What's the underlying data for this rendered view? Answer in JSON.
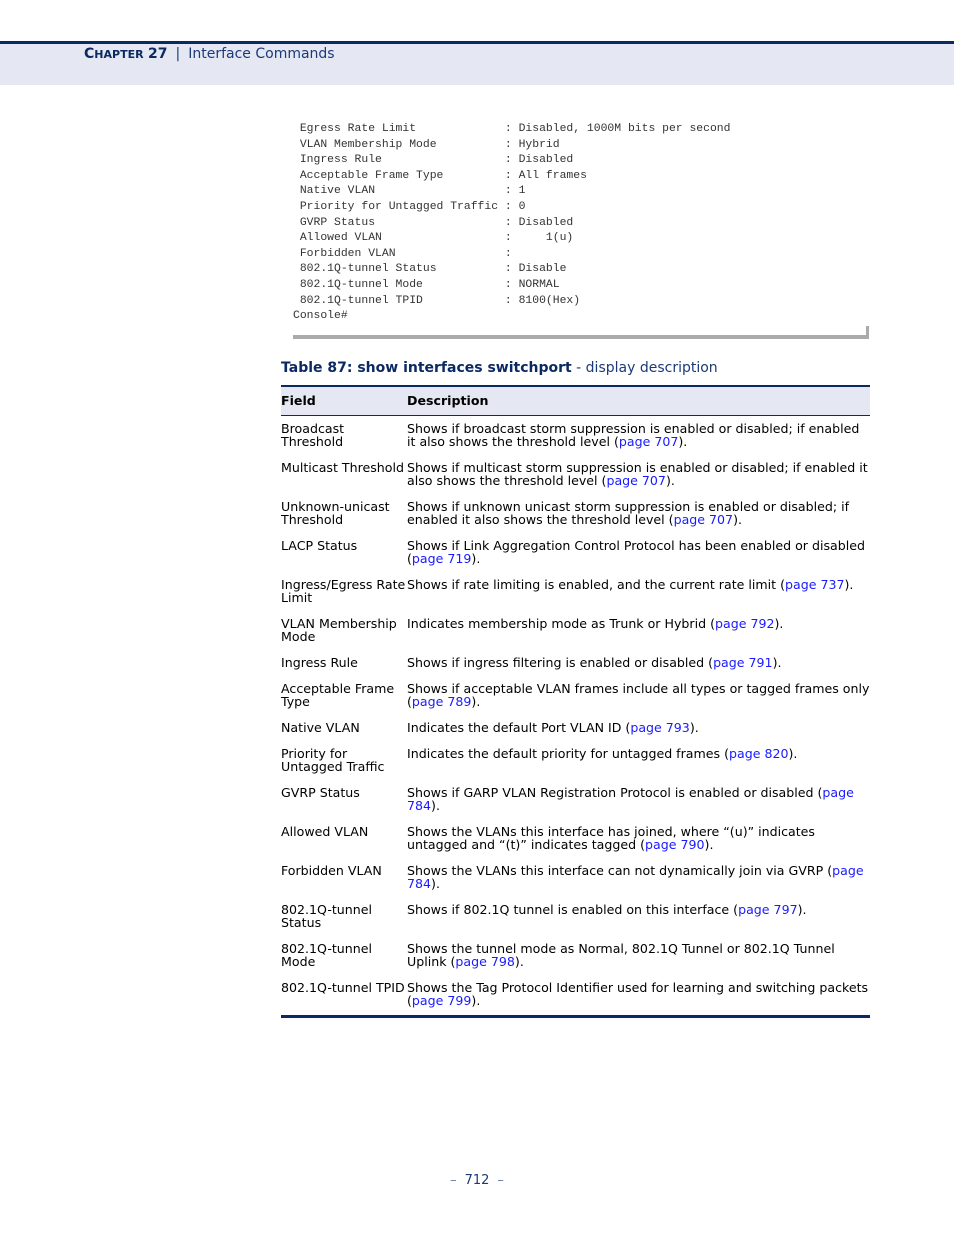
{
  "header": {
    "chapter_label": "Chapter",
    "chapter_number": "27",
    "separator": "|",
    "section_title": "Interface Commands"
  },
  "console": {
    "lines": [
      " Egress Rate Limit             : Disabled, 1000M bits per second",
      " VLAN Membership Mode          : Hybrid",
      " Ingress Rule                  : Disabled",
      " Acceptable Frame Type         : All frames",
      " Native VLAN                   : 1",
      " Priority for Untagged Traffic : 0",
      " GVRP Status                   : Disabled",
      " Allowed VLAN                  :     1(u)",
      " Forbidden VLAN                :",
      " 802.1Q-tunnel Status          : Disable",
      " 802.1Q-tunnel Mode            : NORMAL",
      " 802.1Q-tunnel TPID            : 8100(Hex)",
      "Console#"
    ]
  },
  "table": {
    "title_bold": "Table 87: show interfaces switchport",
    "title_rest": " - display description",
    "columns": [
      "Field",
      "Description"
    ],
    "rows": [
      {
        "field": "Broadcast Threshold",
        "desc": "Shows if broadcast storm suppression is enabled or disabled; if enabled it also shows the threshold level (",
        "link": "page 707",
        "end": ")."
      },
      {
        "field": "Multicast Threshold",
        "desc": "Shows if multicast storm suppression is enabled or disabled; if enabled it also shows the threshold level (",
        "link": "page 707",
        "end": ")."
      },
      {
        "field": "Unknown-unicast Threshold",
        "desc": "Shows if unknown unicast storm suppression is enabled or disabled; if enabled it also shows the threshold level (",
        "link": "page 707",
        "end": ")."
      },
      {
        "field": "LACP Status",
        "desc": "Shows if Link Aggregation Control Protocol has been enabled or disabled (",
        "link": "page 719",
        "end": ")."
      },
      {
        "field": "Ingress/Egress Rate Limit",
        "desc": "Shows if rate limiting is enabled, and the current rate limit (",
        "link": "page 737",
        "end": ")."
      },
      {
        "field": "VLAN Membership Mode",
        "desc": "Indicates membership mode as Trunk or Hybrid (",
        "link": "page 792",
        "end": ")."
      },
      {
        "field": "Ingress Rule",
        "desc": "Shows if ingress filtering is enabled or disabled (",
        "link": "page 791",
        "end": ")."
      },
      {
        "field": "Acceptable Frame Type",
        "desc": "Shows if acceptable VLAN frames include all types or tagged frames only (",
        "link": "page 789",
        "end": ")."
      },
      {
        "field": "Native VLAN",
        "desc": "Indicates the default Port VLAN ID (",
        "link": "page 793",
        "end": ")."
      },
      {
        "field": "Priority for Untagged Traffic",
        "desc": "Indicates the default priority for untagged frames (",
        "link": "page 820",
        "end": ")."
      },
      {
        "field": "GVRP Status",
        "desc": "Shows if GARP VLAN Registration Protocol is enabled or disabled (",
        "link": "page 784",
        "end": ")."
      },
      {
        "field": "Allowed VLAN",
        "desc": "Shows the VLANs this interface has joined, where “(u)” indicates untagged and “(t)” indicates tagged (",
        "link": "page 790",
        "end": ")."
      },
      {
        "field": "Forbidden VLAN",
        "desc": "Shows the VLANs this interface can not dynamically join via GVRP (",
        "link": "page 784",
        "end": ")."
      },
      {
        "field": "802.1Q-tunnel Status",
        "desc": "Shows if 802.1Q tunnel is enabled on this interface (",
        "link": "page 797",
        "end": ")."
      },
      {
        "field": "802.1Q-tunnel Mode",
        "desc": "Shows the tunnel mode as Normal, 802.1Q Tunnel or 802.1Q Tunnel Uplink (",
        "link": "page 798",
        "end": ")."
      },
      {
        "field": "802.1Q-tunnel TPID",
        "desc": "Shows the Tag Protocol Identifier used for learning and switching packets (",
        "link": "page 799",
        "end": ")."
      }
    ]
  },
  "footer": {
    "dash": "–",
    "page_number": "712"
  }
}
